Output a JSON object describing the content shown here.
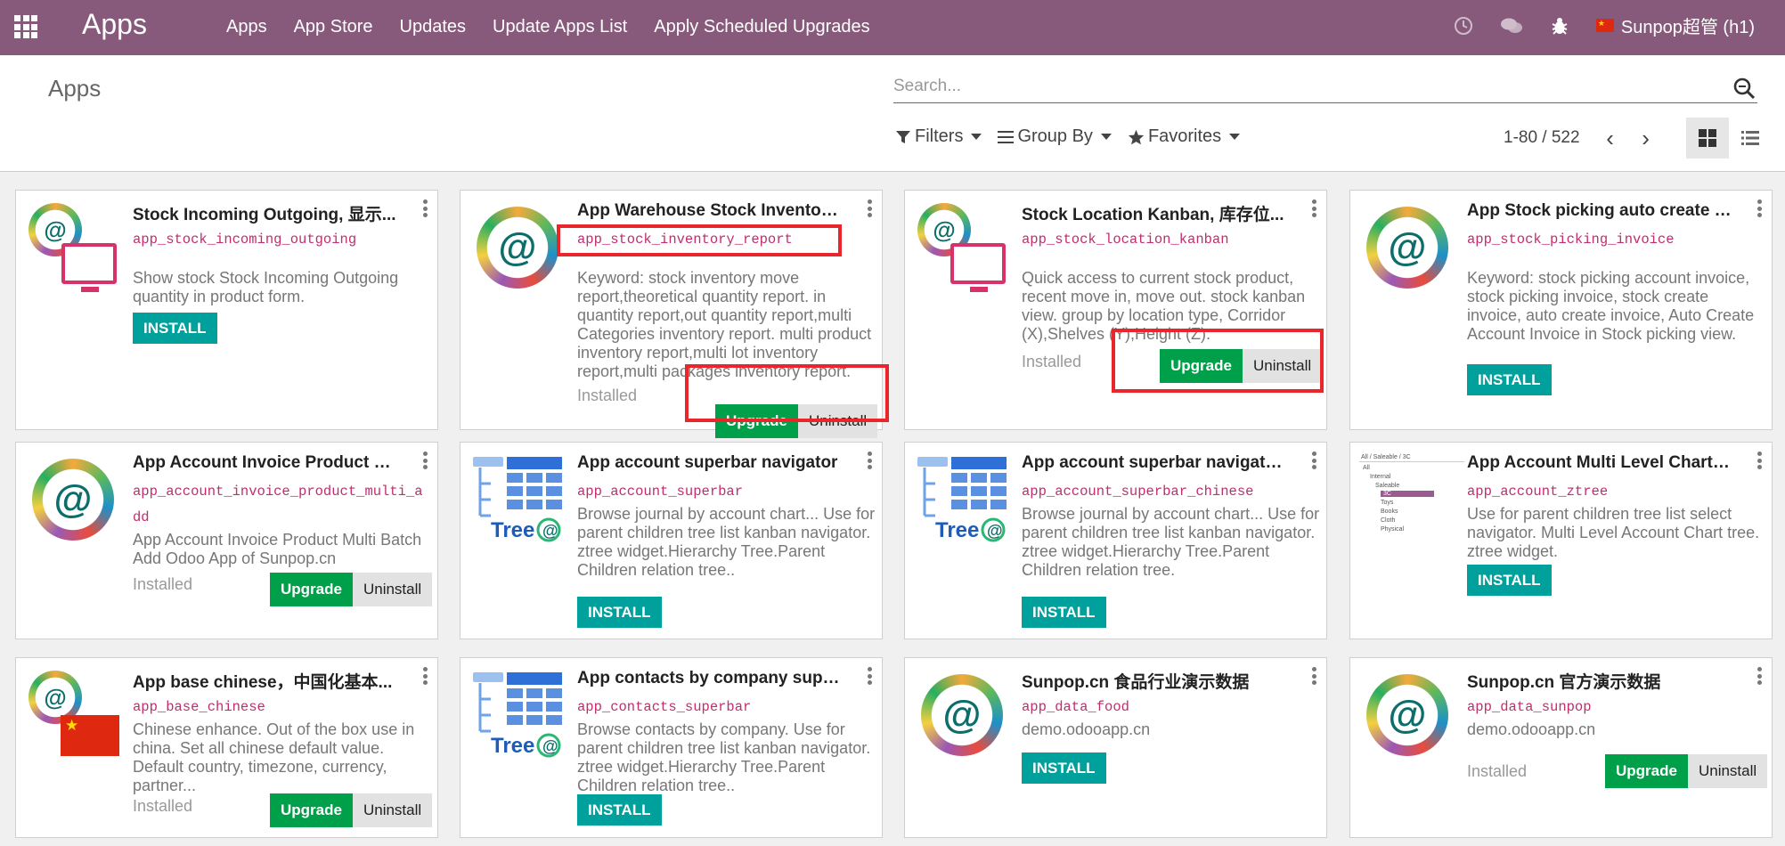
{
  "navbar": {
    "brand": "Apps",
    "menu": [
      "Apps",
      "App Store",
      "Updates",
      "Update Apps List",
      "Apply Scheduled Upgrades"
    ],
    "user": "Sunpop超管 (h1)",
    "icons": [
      "apps-grid-icon",
      "clock-icon",
      "chat-icon",
      "bug-icon"
    ]
  },
  "control": {
    "breadcrumb": "Apps",
    "search_placeholder": "Search...",
    "filters_label": "Filters",
    "groupby_label": "Group By",
    "favorites_label": "Favorites",
    "pager": "1-80 / 522"
  },
  "buttons": {
    "install": "INSTALL",
    "upgrade": "Upgrade",
    "uninstall": "Uninstall",
    "installed": "Installed"
  },
  "cards": [
    {
      "title": "Stock Incoming Outgoing, 显示...",
      "tech": "app_stock_incoming_outgoing",
      "desc": "Show stock Stock Incoming Outgoing quantity in product form.",
      "state": "install",
      "logo": "pp-monitor"
    },
    {
      "title": "App Warehouse Stock Inventory...",
      "tech": "app_stock_inventory_report",
      "desc": "Keyword: stock inventory move report,theoretical quantity report. in quantity report,out quantity report,multi Categories inventory report. multi product inventory report,multi lot inventory report,multi packages inventory report.",
      "state": "installed",
      "logo": "pp"
    },
    {
      "title": "Stock Location Kanban, 库存位...",
      "tech": "app_stock_location_kanban",
      "desc": "Quick access to current stock product, recent move in, move out. stock kanban view. group by location type, Corridor (X),Shelves (Y),Height (Z).",
      "state": "installed",
      "logo": "pp-monitor"
    },
    {
      "title": "App Stock picking auto create in...",
      "tech": "app_stock_picking_invoice",
      "desc": "Keyword: stock picking account invoice, stock picking invoice, stock create invoice, auto create invoice, Auto Create Account Invoice in Stock picking view.",
      "state": "install",
      "logo": "pp"
    },
    {
      "title": "App Account Invoice Product M...",
      "tech": "app_account_invoice_product_multi_add",
      "desc": "App Account Invoice Product Multi Batch Add Odoo App of Sunpop.cn",
      "state": "installed",
      "logo": "pp"
    },
    {
      "title": "App account superbar navigator",
      "tech": "app_account_superbar",
      "desc": "Browse journal by account chart... Use for parent children tree list kanban navigator. ztree widget.Hierarchy Tree.Parent Children relation tree..",
      "state": "install",
      "logo": "tree"
    },
    {
      "title": "App account superbar navigator...",
      "tech": "app_account_superbar_chinese",
      "desc": "Browse journal by account chart... Use for parent children tree list kanban navigator. ztree widget.Hierarchy Tree.Parent Children relation tree.",
      "state": "install",
      "logo": "tree"
    },
    {
      "title": "App Account Multi Level Chart, ...",
      "tech": "app_account_ztree",
      "desc": "Use for parent children tree list select navigator. Multi Level Account Chart tree. ztree widget.",
      "state": "install",
      "logo": "ztree"
    },
    {
      "title": "App base chinese，中国化基本...",
      "tech": "app_base_chinese",
      "desc": "Chinese enhance. Out of the box use in china. Set all chinese default value. Default country, timezone, currency, partner...",
      "state": "installed",
      "logo": "pp-flag"
    },
    {
      "title": "App contacts by company super...",
      "tech": "app_contacts_superbar",
      "desc": "Browse contacts by company. Use for parent children tree list kanban navigator. ztree widget.Hierarchy Tree.Parent Children relation tree..",
      "state": "install",
      "logo": "tree"
    },
    {
      "title": "Sunpop.cn 食品行业演示数据",
      "tech": "app_data_food",
      "desc": "demo.odooapp.cn",
      "state": "install",
      "logo": "pp"
    },
    {
      "title": "Sunpop.cn 官方演示数据",
      "tech": "app_data_sunpop",
      "desc": "demo.odooapp.cn",
      "state": "installed",
      "logo": "pp"
    }
  ],
  "ztree_preview": [
    "All / Saleable / 3C",
    "All",
    "Internal",
    "Saleable",
    "3C",
    "Toys",
    "Books",
    "Cloth",
    "Physical"
  ],
  "colors": {
    "navbar": "#875a7b",
    "install": "#00a09d",
    "upgrade": "#00a04a",
    "tech_name": "#c02e6e",
    "highlight": "#e8262b"
  }
}
